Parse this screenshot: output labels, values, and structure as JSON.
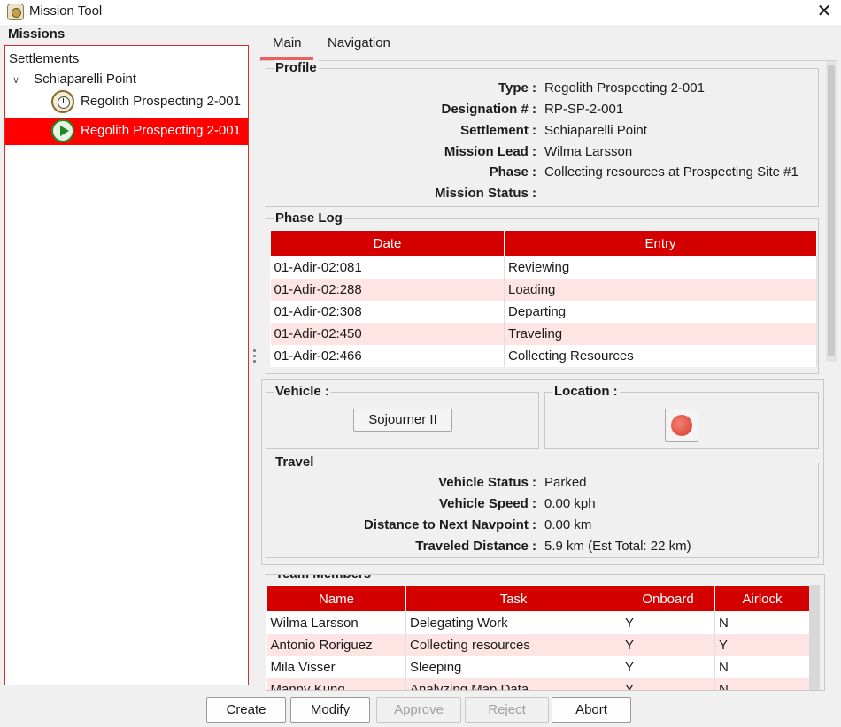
{
  "window": {
    "title": "Mission Tool",
    "close_symbol": "✕"
  },
  "missions": {
    "label": "Missions",
    "root": "Settlements",
    "settlement": "Schiaparelli Point",
    "items": [
      {
        "label": "Regolith Prospecting 2-001",
        "icon": "clock-icon",
        "selected": false
      },
      {
        "label": "Regolith Prospecting 2-001",
        "icon": "play-icon",
        "selected": true
      }
    ]
  },
  "tabs": [
    {
      "label": "Main"
    },
    {
      "label": "Navigation"
    }
  ],
  "profile": {
    "title": "Profile",
    "rows": [
      {
        "key": "Type :",
        "value": "Regolith Prospecting 2-001"
      },
      {
        "key": "Designation # :",
        "value": "RP-SP-2-001"
      },
      {
        "key": "Settlement :",
        "value": "Schiaparelli Point"
      },
      {
        "key": "Mission Lead :",
        "value": "Wilma Larsson"
      },
      {
        "key": "Phase :",
        "value": "Collecting resources at Prospecting Site #1"
      },
      {
        "key": "Mission Status :",
        "value": ""
      }
    ]
  },
  "phase_log": {
    "title": "Phase Log",
    "columns": [
      "Date",
      "Entry"
    ],
    "rows": [
      [
        "01-Adir-02:081",
        "Reviewing"
      ],
      [
        "01-Adir-02:288",
        "Loading"
      ],
      [
        "01-Adir-02:308",
        "Departing"
      ],
      [
        "01-Adir-02:450",
        "Traveling"
      ],
      [
        "01-Adir-02:466",
        "Collecting Resources"
      ]
    ]
  },
  "vehicle": {
    "title": "Vehicle :",
    "button": "Sojourner II"
  },
  "location": {
    "title": "Location :"
  },
  "travel": {
    "title": "Travel",
    "rows": [
      {
        "key": "Vehicle Status :",
        "value": "Parked"
      },
      {
        "key": "Vehicle Speed :",
        "value": "0.00 kph"
      },
      {
        "key": "Distance to Next Navpoint :",
        "value": "0.00 km"
      },
      {
        "key": "Traveled Distance :",
        "value": "5.9 km (Est Total: 22 km)"
      }
    ]
  },
  "team": {
    "title": "Team Members",
    "columns": [
      "Name",
      "Task",
      "Onboard",
      "Airlock"
    ],
    "rows": [
      [
        "Wilma Larsson",
        "Delegating Work",
        "Y",
        "N"
      ],
      [
        "Antonio Roriguez",
        "Collecting resources",
        "Y",
        "Y"
      ],
      [
        "Mila Visser",
        "Sleeping",
        "Y",
        "N"
      ],
      [
        "Manny Kung",
        "Analyzing Map Data",
        "Y",
        "N"
      ]
    ]
  },
  "buttons": {
    "create": "Create",
    "modify": "Modify",
    "approve": "Approve",
    "reject": "Reject",
    "abort": "Abort"
  },
  "colors": {
    "accent": "#d40000",
    "selection": "#ff0000",
    "alt_row": "#ffe4e4"
  }
}
